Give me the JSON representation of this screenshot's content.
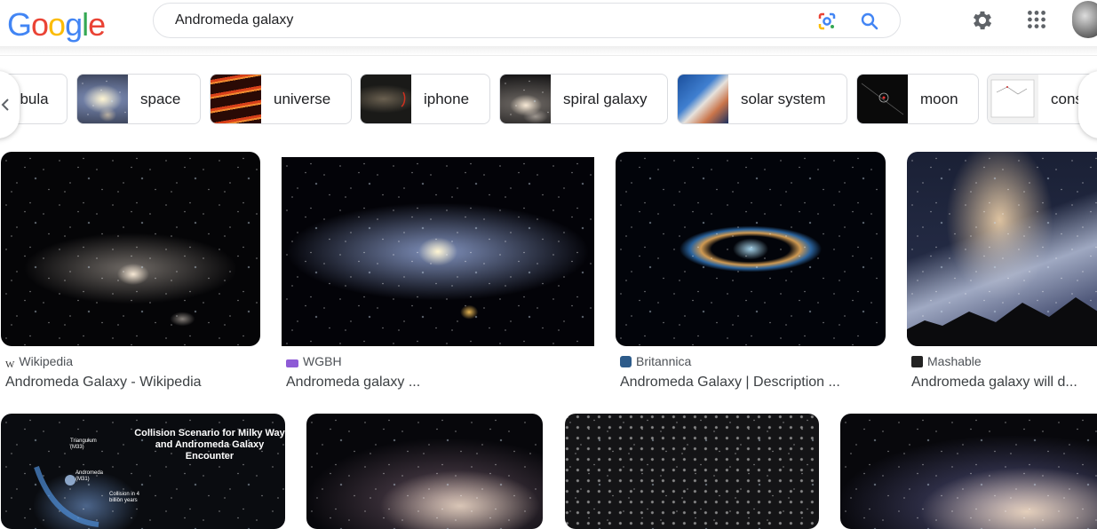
{
  "search": {
    "query": "Andromeda galaxy"
  },
  "logo": {
    "letters": [
      "G",
      "o",
      "o",
      "g",
      "l",
      "e"
    ],
    "colors": [
      "#4285F4",
      "#EA4335",
      "#FBBC05",
      "#4285F4",
      "#34A853",
      "#EA4335"
    ]
  },
  "icons": {
    "lens": "google-lens-icon",
    "search": "search-icon",
    "settings": "gear-icon",
    "apps": "apps-grid-icon"
  },
  "chips": [
    {
      "label": "ebula"
    },
    {
      "label": "space"
    },
    {
      "label": "universe"
    },
    {
      "label": "iphone"
    },
    {
      "label": "spiral galaxy"
    },
    {
      "label": "solar system"
    },
    {
      "label": "moon"
    },
    {
      "label": "cons"
    }
  ],
  "results": [
    {
      "source": "Wikipedia",
      "title": "Andromeda Galaxy - Wikipedia"
    },
    {
      "source": "WGBH",
      "title": "Andromeda galaxy ..."
    },
    {
      "source": "Britannica",
      "title": "Andromeda Galaxy | Description ..."
    },
    {
      "source": "Mashable",
      "title": "Andromeda galaxy will d..."
    }
  ],
  "row2": {
    "collision_title": "Collision Scenario for Milky Way and Andromeda Galaxy Encounter",
    "labels": [
      "Triangulum (M33)",
      "Andromeda (M31)",
      "Collision in 4 billion years"
    ]
  },
  "colors": {
    "accent_blue": "#1a73e8",
    "text": "#202124",
    "muted": "#4d5156"
  }
}
